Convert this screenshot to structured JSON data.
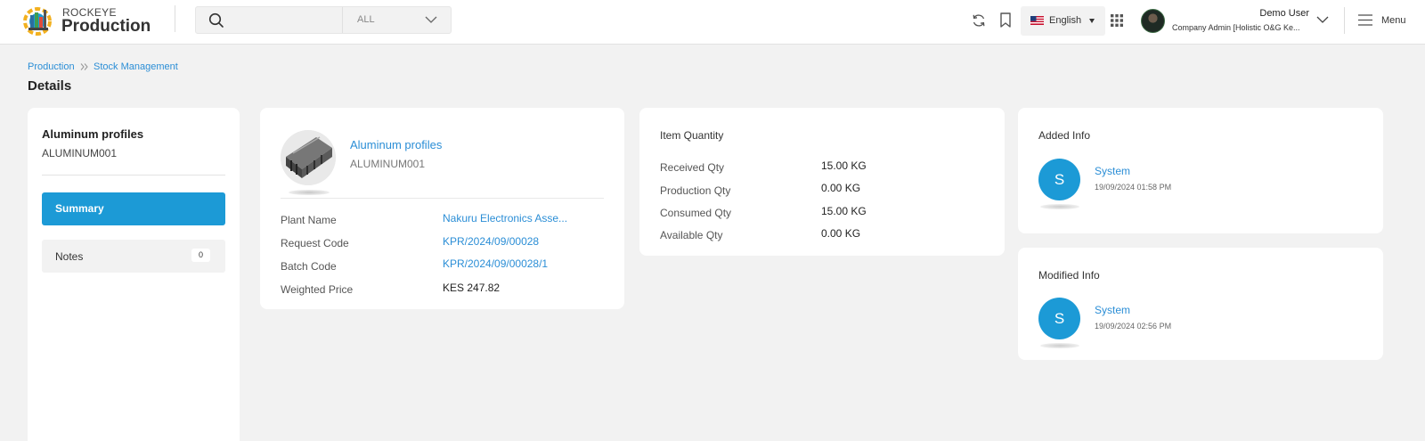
{
  "header": {
    "brand_top": "ROCKEYE",
    "brand_main": "Production",
    "search_placeholder": "",
    "search_scope": "ALL",
    "language": "English",
    "user_name": "Demo User",
    "user_role": "Company Admin [Holistic O&G Ke...",
    "menu_label": "Menu"
  },
  "breadcrumb": {
    "items": [
      "Production",
      "Stock Management"
    ]
  },
  "page_title": "Details",
  "sidebar": {
    "item_name": "Aluminum profiles",
    "item_code": "ALUMINUM001",
    "summary_label": "Summary",
    "notes_label": "Notes",
    "notes_count": "0"
  },
  "product": {
    "name": "Aluminum profiles",
    "code": "ALUMINUM001",
    "fields": [
      {
        "label": "Plant Name",
        "value": "Nakuru Electronics Asse..."
      },
      {
        "label": "Request Code",
        "value": "KPR/2024/09/00028"
      },
      {
        "label": "Batch Code",
        "value": "KPR/2024/09/00028/1"
      },
      {
        "label": "Weighted Price",
        "value": "KES 247.82"
      }
    ]
  },
  "quantity": {
    "title": "Item Quantity",
    "rows": [
      {
        "label": "Received Qty",
        "value": "15.00 KG"
      },
      {
        "label": "Production Qty",
        "value": "0.00 KG"
      },
      {
        "label": "Consumed Qty",
        "value": "15.00 KG"
      },
      {
        "label": "Available Qty",
        "value": "0.00 KG"
      }
    ]
  },
  "added_info": {
    "title": "Added Info",
    "avatar_letter": "S",
    "user": "System",
    "date": "19/09/2024 01:58 PM"
  },
  "modified_info": {
    "title": "Modified Info",
    "avatar_letter": "S",
    "user": "System",
    "date": "19/09/2024 02:56 PM"
  },
  "colors": {
    "accent": "#1c9ad6",
    "link": "#2b8ed6",
    "background": "#f2f2f2"
  }
}
